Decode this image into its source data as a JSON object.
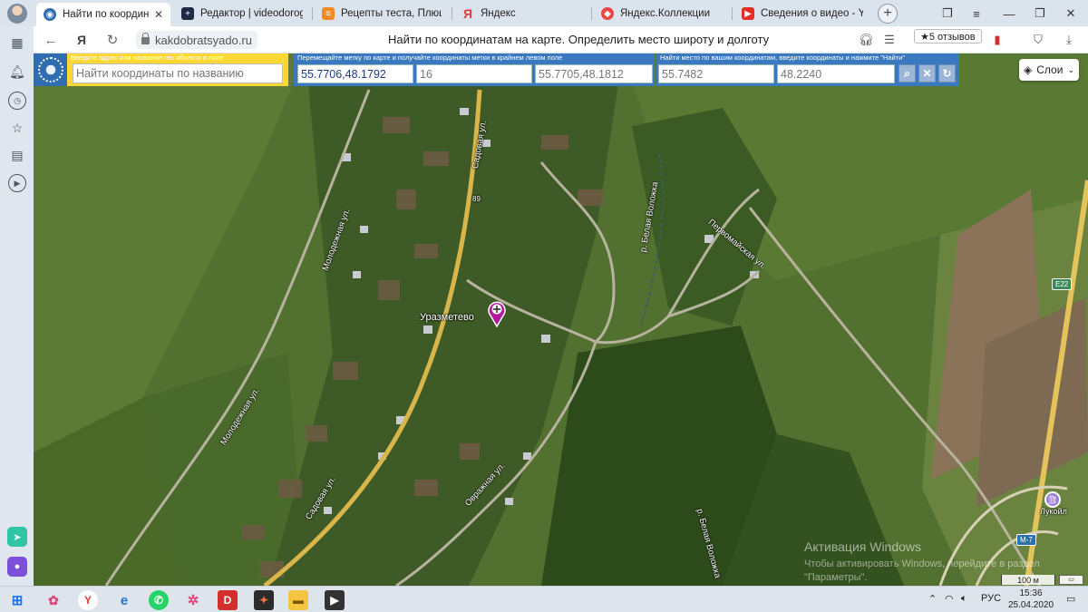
{
  "browser": {
    "tabs": [
      {
        "label": "Найти по координатам",
        "active": true,
        "icon": "site-globe-icon",
        "color": "#2f6db0"
      },
      {
        "label": "Редактор | videodorogros",
        "active": false,
        "icon": "editor-plus-icon",
        "color": "#1f2a44"
      },
      {
        "label": "Рецепты теста, Плюшка к",
        "active": false,
        "icon": "recipes-icon",
        "color": "#f08a24"
      },
      {
        "label": "Яндекс",
        "active": false,
        "icon": "yandex-y-icon",
        "color": "#e53935"
      },
      {
        "label": "Яндекс.Коллекции",
        "active": false,
        "icon": "collections-icon",
        "color": "#ef4444"
      },
      {
        "label": "Сведения о видео - YouT",
        "active": false,
        "icon": "youtube-icon",
        "color": "#e52d27"
      }
    ],
    "url": "kakdobratsyado.ru",
    "page_title": "Найти по координатам на карте. Определить место широту и долготу",
    "reviews": "★5 отзывов"
  },
  "map": {
    "geo_search": {
      "hint": "Введите адрес или название гео объекта в поле",
      "placeholder": "Найти координаты по названию"
    },
    "marker_coords": {
      "hint": "Перемещайте метку по карте и получайте координаты метки в крайнем левом поле",
      "value": "55.7706,48.1792",
      "zoom": "16",
      "center": "55.7705,48.1812"
    },
    "find_place": {
      "hint": "Найти место по вашим координатам, введите координаты и нажмите \"Найти\"",
      "lat": "55.7482",
      "lon": "48.2240"
    },
    "layers_button": "Слои",
    "labels": {
      "village": "Уразметево",
      "sadovaya_top": "Садовая ул.",
      "sadovaya_bottom": "Садовая ул.",
      "molodezhnaya_top": "Молодежная ул.",
      "molodezhnaya_bottom": "Молодежная ул.",
      "river_top": "р. Белая Воложка",
      "river_bottom": "р. Белая Воложка",
      "ovrazhnaya": "Овражная ул.",
      "pervomaiskaya": "Первомайская ул.",
      "house_number": "89",
      "lukoil": "Лукойл",
      "e22": "E22",
      "m7": "M-7"
    },
    "scale_label": "100 м",
    "watermark_title": "Активация Windows",
    "watermark_text_1": "Чтобы активировать Windows, перейдите в раздел",
    "watermark_text_2": "\"Параметры\"."
  },
  "taskbar": {
    "language": "РУС",
    "time": "15:36",
    "date": "25.04.2020"
  }
}
